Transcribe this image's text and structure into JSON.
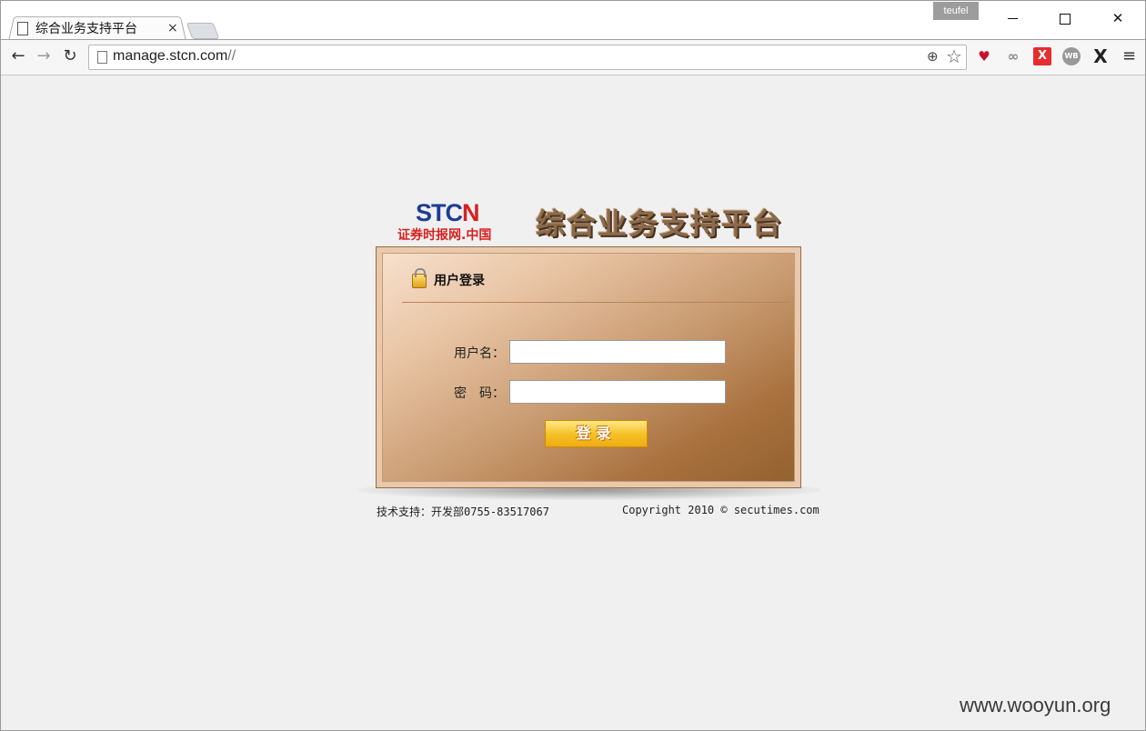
{
  "browser": {
    "tab_title": "综合业务支持平台",
    "tab_close": "×",
    "profile_name": "teufel",
    "url_main": "manage.stcn.com",
    "url_suffix": "//",
    "icons": [
      "back-arrow-icon",
      "forward-arrow-icon",
      "reload-icon",
      "page-icon",
      "zoom-icon",
      "bookmark-star-icon",
      "heart-extension-icon",
      "links-extension-icon",
      "x-extension-icon",
      "wb-extension-icon",
      "x-logo-extension-icon",
      "menu-icon"
    ]
  },
  "logo": {
    "main_blue": "STC",
    "main_red": "N",
    "subtitle": "证券时报网.中国"
  },
  "platform_title": "综合业务支持平台",
  "login": {
    "panel_title": "用户登录",
    "username_label": "用户名：",
    "password_label": "密　码：",
    "username_value": "",
    "password_value": "",
    "submit_label": "登录"
  },
  "footer": {
    "support": "技术支持：开发部0755-83517067",
    "copyright": "Copyright 2010 © secutimes.com"
  },
  "watermark": "www.wooyun.org",
  "colors": {
    "panel_light": "#f7e0cc",
    "panel_dark": "#93622f",
    "button": "#f5c22a",
    "logo_blue": "#1c3d96",
    "logo_red": "#d82020"
  }
}
